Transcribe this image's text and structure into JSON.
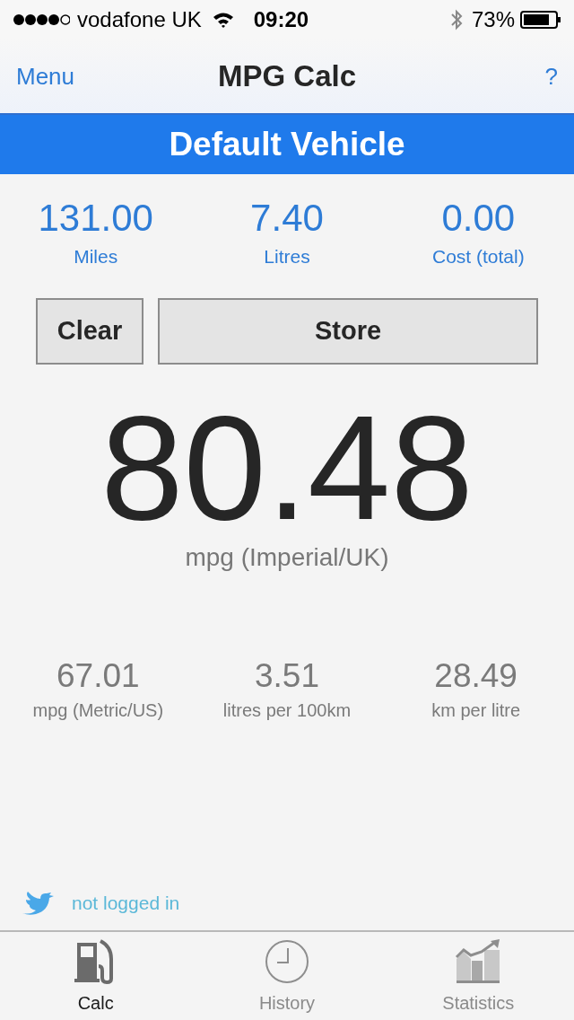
{
  "status_bar": {
    "carrier": "vodafone UK",
    "time": "09:20",
    "battery": "73%"
  },
  "nav": {
    "left": "Menu",
    "title": "MPG Calc",
    "right": "?"
  },
  "vehicle": "Default Vehicle",
  "inputs": [
    {
      "value": "131.00",
      "label": "Miles"
    },
    {
      "value": "7.40",
      "label": "Litres"
    },
    {
      "value": "0.00",
      "label": "Cost (total)"
    }
  ],
  "buttons": [
    "Clear",
    "Store"
  ],
  "result": {
    "value": "80.48",
    "unit": "mpg (Imperial/UK)"
  },
  "conversions": [
    {
      "value": "67.01",
      "unit": "mpg (Metric/US)"
    },
    {
      "value": "3.51",
      "unit": "litres per 100km"
    },
    {
      "value": "28.49",
      "unit": "km per litre"
    }
  ],
  "twitter": "not logged in",
  "tabs": [
    {
      "kind": "pump",
      "label": "Calc",
      "selected": true
    },
    {
      "kind": "clock",
      "label": "History",
      "selected": false
    },
    {
      "kind": "chart",
      "label": "Statistics",
      "selected": false
    }
  ]
}
